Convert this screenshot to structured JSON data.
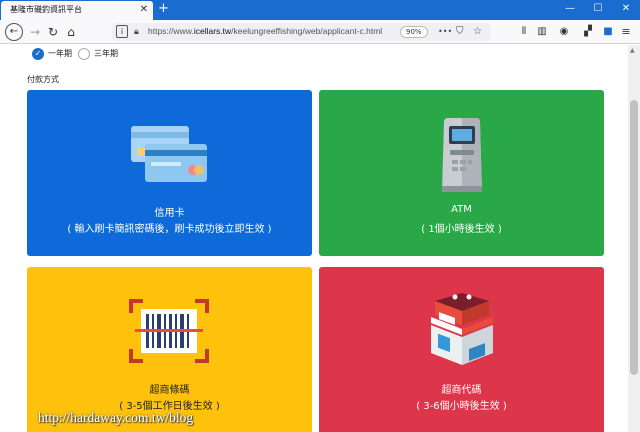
{
  "browser": {
    "tab_title": "基隆市磯釣資訊平台",
    "tab_close": "✕",
    "new_tab": "+",
    "win_min": "—",
    "win_max": "☐",
    "win_close": "✕",
    "url_prefix": "https://www.",
    "url_domain": "icellars.tw",
    "url_path": "/keelungreeffishing/web/applicant-c.html",
    "zoom": "90%",
    "more": "•••"
  },
  "plan": {
    "option_1": "一年期",
    "option_2": "三年期",
    "selected": "一年期"
  },
  "payment": {
    "section_label": "付款方式",
    "cards": [
      {
        "title": "信用卡",
        "subtitle": "( 輸入刷卡簡訊密碼後，刷卡成功後立即生效 )",
        "color": "#0f6ad9",
        "icon": "credit-card-icon"
      },
      {
        "title": "ATM",
        "subtitle": "( 1個小時後生效 )",
        "color": "#2aa847",
        "icon": "atm-icon"
      },
      {
        "title": "超商條碼",
        "subtitle": "( 3-5個工作日後生效 )",
        "color": "#fec10c",
        "icon": "barcode-scan-icon"
      },
      {
        "title": "超商代碼",
        "subtitle": "( 3-6個小時後生效 )",
        "color": "#dd3549",
        "icon": "shop-icon"
      }
    ]
  },
  "watermark": "http://hardaway.com.tw/blog"
}
